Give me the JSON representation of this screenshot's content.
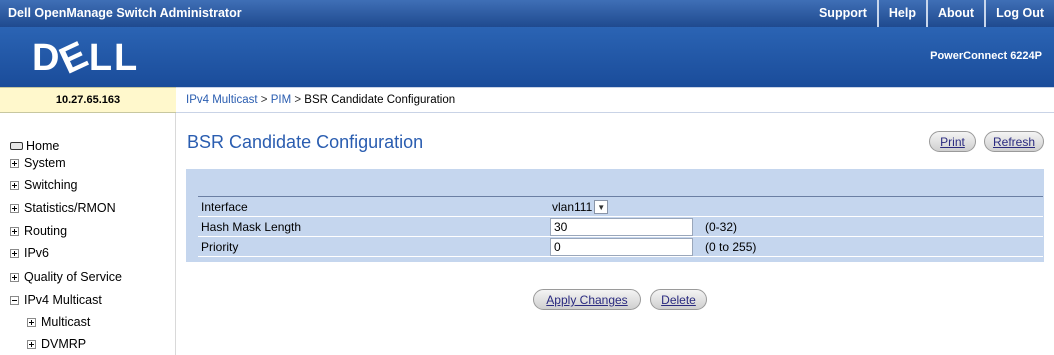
{
  "app": {
    "title": "Dell OpenManage Switch Administrator",
    "links": [
      "Support",
      "Help",
      "About",
      "Log Out"
    ],
    "logo": "DELL",
    "model": "PowerConnect 6224P"
  },
  "ip_address": "10.27.65.163",
  "breadcrumb": {
    "items": [
      "IPv4 Multicast",
      "PIM",
      "BSR Candidate Configuration"
    ],
    "separator": ">"
  },
  "sidebar": {
    "items": [
      {
        "label": "Home",
        "icon": "home-icon"
      },
      {
        "label": "System",
        "icon": "expand-plus-icon"
      },
      {
        "label": "Switching",
        "icon": "expand-plus-icon"
      },
      {
        "label": "Statistics/RMON",
        "icon": "expand-plus-icon"
      },
      {
        "label": "Routing",
        "icon": "expand-plus-icon"
      },
      {
        "label": "IPv6",
        "icon": "expand-plus-icon"
      },
      {
        "label": "Quality of Service",
        "icon": "expand-plus-icon"
      },
      {
        "label": "IPv4 Multicast",
        "icon": "collapse-minus-icon"
      },
      {
        "label": "Multicast",
        "icon": "expand-plus-icon"
      },
      {
        "label": "DVMRP",
        "icon": "expand-plus-icon"
      }
    ]
  },
  "page": {
    "title": "BSR Candidate Configuration",
    "print_label": "Print",
    "refresh_label": "Refresh"
  },
  "form": {
    "interface": {
      "label": "Interface",
      "value": "vlan111"
    },
    "hash_mask_length": {
      "label": "Hash Mask Length",
      "value": "30",
      "range": "(0-32)"
    },
    "priority": {
      "label": "Priority",
      "value": "0",
      "range": "(0 to 255)"
    }
  },
  "actions": {
    "apply_label": "Apply Changes",
    "delete_label": "Delete"
  }
}
